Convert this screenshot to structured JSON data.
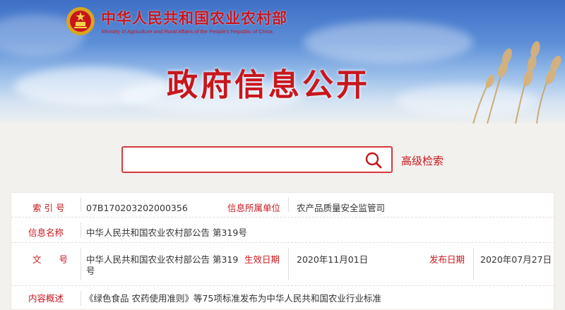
{
  "header": {
    "ministry_cn": "中华人民共和国农业农村部",
    "ministry_en": "Ministry of Agriculture and Rural Affairs of the People's Republic of China",
    "page_title": "政府信息公开",
    "emblem_icon": "national-emblem-icon"
  },
  "search": {
    "value": "",
    "placeholder": "",
    "icon": "search-icon",
    "advanced_label": "高级检索"
  },
  "info": {
    "index_label": "索 引 号",
    "index_value": "07B170203202000356",
    "unit_label": "信息所属单位",
    "unit_value": "农产品质量安全监管司",
    "name_label": "信息名称",
    "name_value": "中华人民共和国农业农村部公告 第319号",
    "doc_label": "文　　号",
    "doc_value_line1": "中华人民共和国农业农村部公告 第319",
    "doc_value_line2": "号",
    "effective_label": "生效日期",
    "effective_value": "2020年11月01日",
    "publish_label": "发布日期",
    "publish_value": "2020年07月27日",
    "summary_label": "内容概述",
    "summary_value": "《绿色食品 农药使用准则》等75项标准发布为中华人民共和国农业行业标准"
  },
  "colors": {
    "brand_red": "#c8161d",
    "sky_top": "#3d6fc6",
    "page_bg": "#f3f1ee"
  }
}
